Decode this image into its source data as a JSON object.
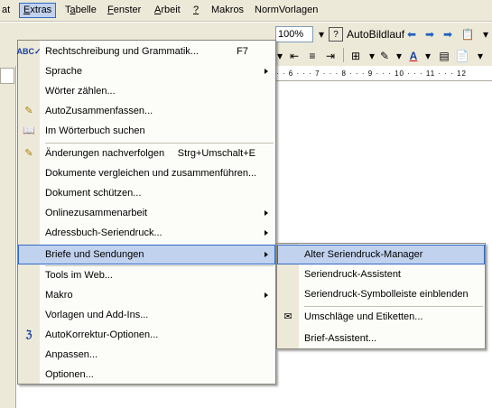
{
  "menubar": {
    "items": [
      {
        "label": "at"
      },
      {
        "label": "Extras"
      },
      {
        "label": "Tabelle"
      },
      {
        "label": "Fenster"
      },
      {
        "label": "Arbeit"
      },
      {
        "label": "?"
      },
      {
        "label": "Makros"
      },
      {
        "label": "NormVorlagen"
      }
    ]
  },
  "toolbar": {
    "zoom_value": "100%",
    "autobildlauf_label": "AutoBildlauf",
    "help_icon": "question-icon"
  },
  "ruler": {
    "text": "· · 6 · · · 7 · · · 8 · · · 9 · · · 10 · · · 11 · · · 12"
  },
  "extras_menu": {
    "items": [
      {
        "label": "Rechtschreibung und Grammatik...",
        "shortcut": "F7",
        "icon": "spellcheck-icon"
      },
      {
        "label": "Sprache",
        "submenu": true
      },
      {
        "label": "Wörter zählen..."
      },
      {
        "label": "AutoZusammenfassen...",
        "icon": "autosummarize-icon"
      },
      {
        "label": "Im Wörterbuch suchen",
        "icon": "dictionary-icon"
      },
      {
        "label": "Änderungen nachverfolgen",
        "shortcut": "Strg+Umschalt+E",
        "icon": "track-changes-icon"
      },
      {
        "label": "Dokumente vergleichen und zusammenführen..."
      },
      {
        "label": "Dokument schützen..."
      },
      {
        "label": "Onlinezusammenarbeit",
        "submenu": true
      },
      {
        "label": "Adressbuch-Seriendruck...",
        "submenu": true
      },
      {
        "label": "Briefe und Sendungen",
        "submenu": true
      },
      {
        "label": "Tools im Web..."
      },
      {
        "label": "Makro",
        "submenu": true
      },
      {
        "label": "Vorlagen und Add-Ins..."
      },
      {
        "label": "AutoKorrektur-Optionen...",
        "icon": "autocorrect-icon"
      },
      {
        "label": "Anpassen..."
      },
      {
        "label": "Optionen..."
      }
    ]
  },
  "briefe_submenu": {
    "items": [
      {
        "label": "Alter Seriendruck-Manager"
      },
      {
        "label": "Seriendruck-Assistent"
      },
      {
        "label": "Seriendruck-Symbolleiste einblenden"
      },
      {
        "label": "Umschläge und Etiketten...",
        "icon": "envelope-icon"
      },
      {
        "label": "Brief-Assistent..."
      }
    ]
  },
  "colors": {
    "menu_bg": "#fcfcf9",
    "menu_strip": "#ece9d8",
    "highlight_bg": "#c1d2ee",
    "highlight_border": "#316ac5"
  }
}
